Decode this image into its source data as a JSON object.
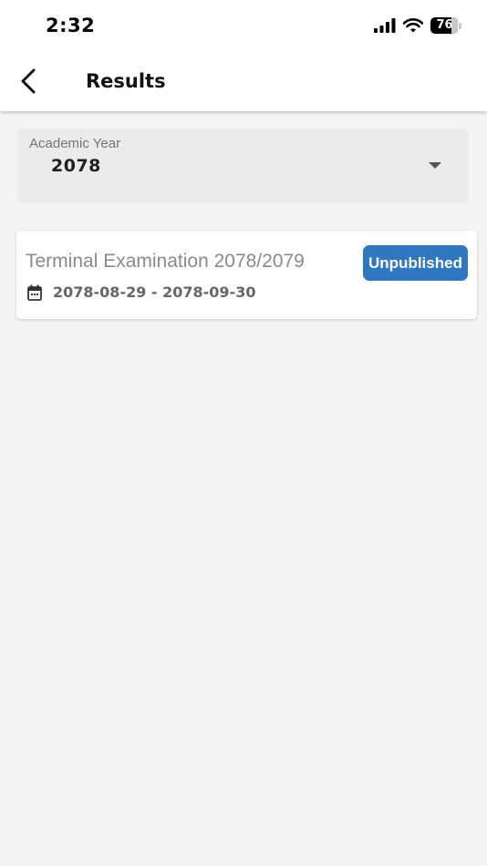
{
  "status_bar": {
    "time": "2:32",
    "battery": "76",
    "battery_level": 0.76
  },
  "header": {
    "title": "Results",
    "back_icon": "chevron-left-icon"
  },
  "academic_year": {
    "label": "Academic Year",
    "value": "2078"
  },
  "results": [
    {
      "name": "Terminal Examination 2078/2079",
      "date_range": "2078-08-29 - 2078-09-30",
      "status": "Unpublished",
      "status_color": "#2f77c1"
    }
  ],
  "colors": {
    "background": "#f4f4f4",
    "accent": "#2f77c1"
  }
}
